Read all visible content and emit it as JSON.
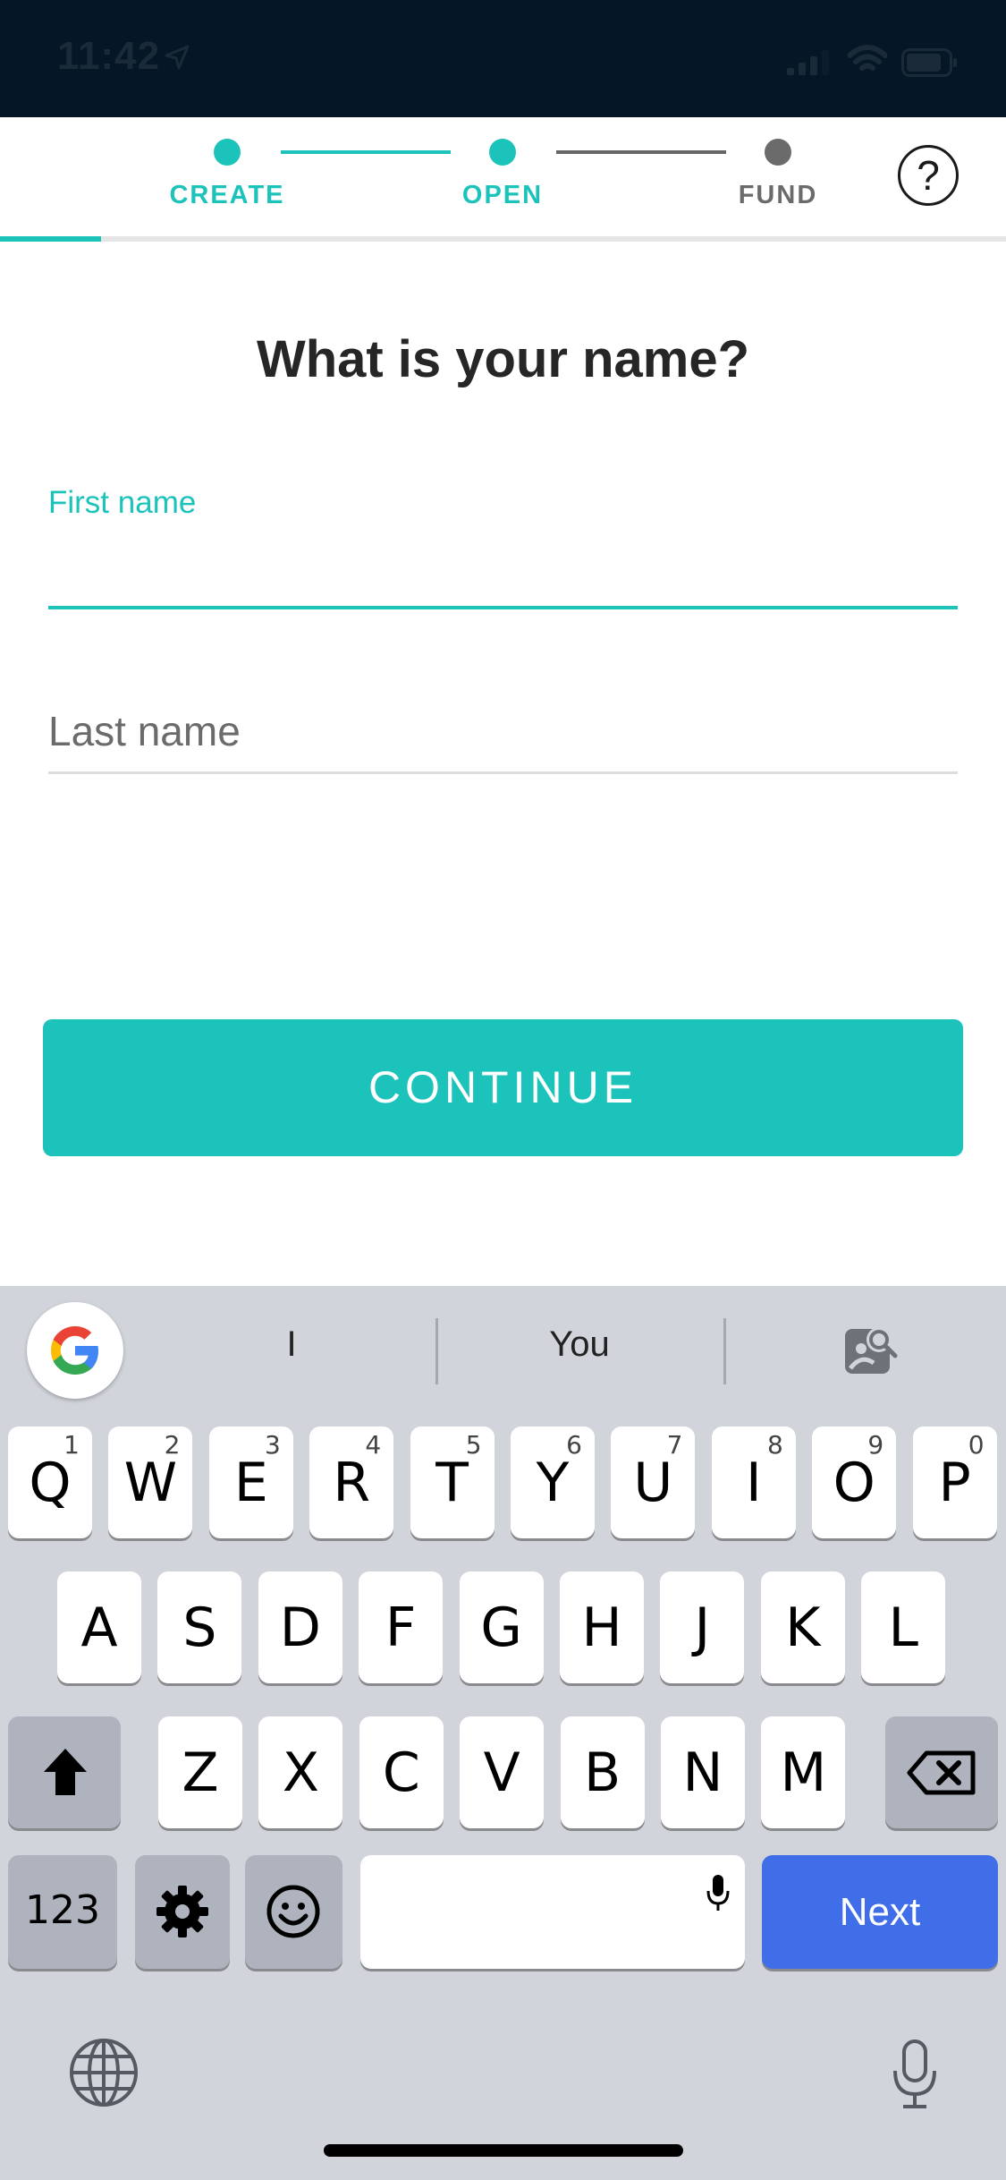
{
  "status_bar": {
    "time": "11:42"
  },
  "stepper": {
    "steps": [
      {
        "label": "CREATE"
      },
      {
        "label": "OPEN"
      },
      {
        "label": "FUND"
      }
    ],
    "help_label": "?",
    "progress_fraction": 0.1
  },
  "form": {
    "title": "What is your name?",
    "first_name_label": "First name",
    "first_name_value": "",
    "last_name_placeholder": "Last name",
    "continue_label": "CONTINUE"
  },
  "keyboard": {
    "suggestions": [
      "I",
      "You"
    ],
    "row1": [
      {
        "key": "Q",
        "num": "1"
      },
      {
        "key": "W",
        "num": "2"
      },
      {
        "key": "E",
        "num": "3"
      },
      {
        "key": "R",
        "num": "4"
      },
      {
        "key": "T",
        "num": "5"
      },
      {
        "key": "Y",
        "num": "6"
      },
      {
        "key": "U",
        "num": "7"
      },
      {
        "key": "I",
        "num": "8"
      },
      {
        "key": "O",
        "num": "9"
      },
      {
        "key": "P",
        "num": "0"
      }
    ],
    "row2": [
      "A",
      "S",
      "D",
      "F",
      "G",
      "H",
      "J",
      "K",
      "L"
    ],
    "row3": [
      "Z",
      "X",
      "C",
      "V",
      "B",
      "N",
      "M"
    ],
    "numbers_key": "123",
    "next_label": "Next"
  },
  "colors": {
    "accent": "#1cc3bb",
    "status_bar_bg": "#051626",
    "next_key": "#3f6ee8"
  }
}
